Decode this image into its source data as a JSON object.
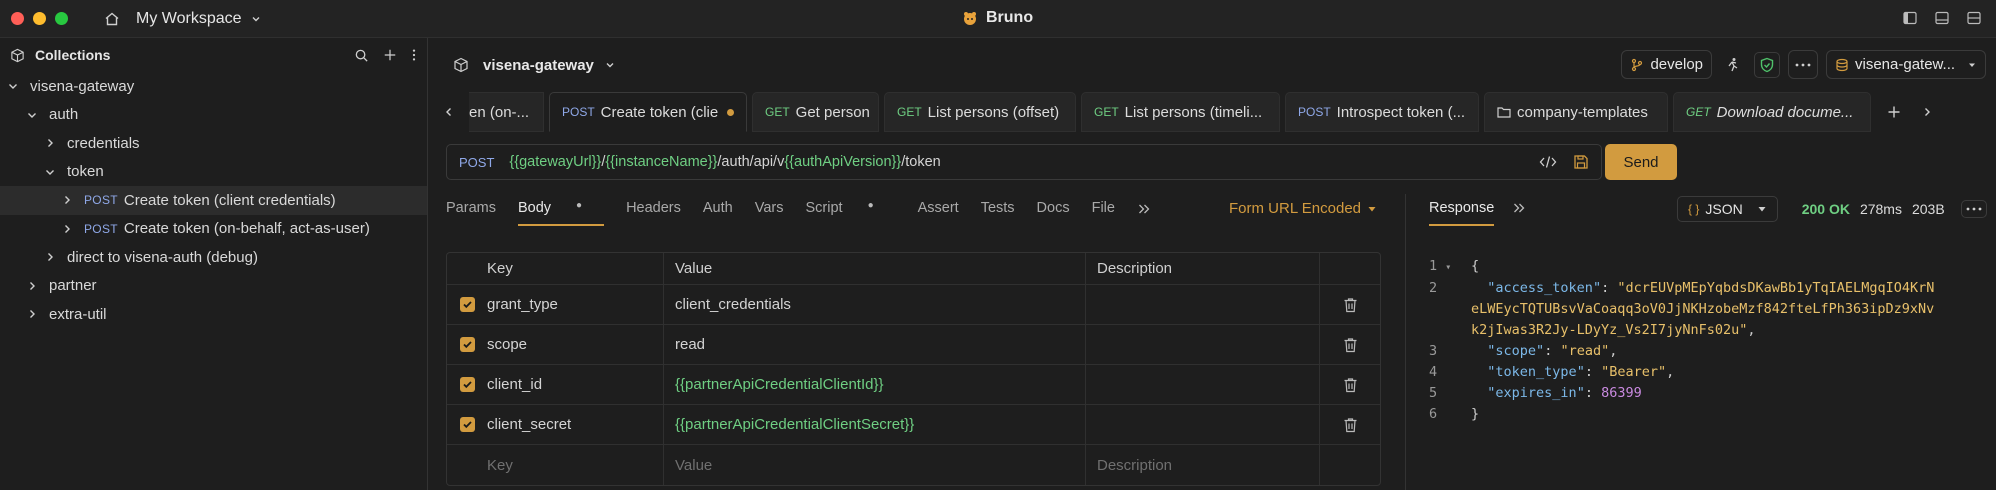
{
  "window": {
    "workspace": "My Workspace",
    "app_title": "Bruno"
  },
  "sidebar": {
    "title": "Collections",
    "tree": [
      {
        "label": "visena-gateway",
        "level": 0,
        "expanded": true
      },
      {
        "label": "auth",
        "level": 1,
        "expanded": true
      },
      {
        "label": "credentials",
        "level": 2,
        "expanded": false
      },
      {
        "label": "token",
        "level": 2,
        "expanded": true
      },
      {
        "method": "POST",
        "label": "Create token (client credentials)",
        "level": 3,
        "selected": true
      },
      {
        "method": "POST",
        "label": "Create token (on-behalf, act-as-user)",
        "level": 3
      },
      {
        "label": "direct to visena-auth (debug)",
        "level": 2,
        "expanded": false
      },
      {
        "label": "partner",
        "level": 1,
        "expanded": false
      },
      {
        "label": "extra-util",
        "level": 1,
        "expanded": false
      }
    ]
  },
  "collection": {
    "name": "visena-gateway",
    "branch": "develop",
    "environment": "visena-gatew..."
  },
  "tabs": [
    {
      "method": "",
      "label": "en (on-..."
    },
    {
      "method": "POST",
      "label": "Create token (clie",
      "active": true,
      "modified": true
    },
    {
      "method": "GET",
      "label": "Get person"
    },
    {
      "method": "GET",
      "label": "List persons (offset)"
    },
    {
      "method": "GET",
      "label": "List persons (timeli..."
    },
    {
      "method": "POST",
      "label": "Introspect token (..."
    },
    {
      "method": "",
      "label": "company-templates",
      "folder": true
    },
    {
      "method": "GET",
      "label": "Download docume...",
      "italic": true
    }
  ],
  "request": {
    "method": "POST",
    "url_parts": [
      {
        "text": "{{gatewayUrl}}",
        "var": true
      },
      {
        "text": "/",
        "var": false
      },
      {
        "text": "{{instanceName}}",
        "var": true
      },
      {
        "text": "/auth/api/v",
        "var": false
      },
      {
        "text": "{{authApiVersion}}",
        "var": true
      },
      {
        "text": "/token",
        "var": false
      }
    ],
    "send_label": "Send",
    "req_tabs": [
      "Params",
      "Body",
      "Headers",
      "Auth",
      "Vars",
      "Script",
      "Assert",
      "Tests",
      "Docs",
      "File"
    ],
    "body_mode": "Form URL Encoded",
    "table": {
      "headers": [
        "Key",
        "Value",
        "Description"
      ],
      "rows": [
        {
          "key": "grant_type",
          "value": "client_credentials",
          "var": false
        },
        {
          "key": "scope",
          "value": "read",
          "var": false
        },
        {
          "key": "client_id",
          "value": "{{partnerApiCredentialClientId}}",
          "var": true
        },
        {
          "key": "client_secret",
          "value": "{{partnerApiCredentialClientSecret}}",
          "var": true
        }
      ],
      "placeholders": {
        "key": "Key",
        "value": "Value",
        "description": "Description"
      }
    }
  },
  "response": {
    "tab_label": "Response",
    "format": "JSON",
    "status": "200 OK",
    "time": "278ms",
    "size": "203B",
    "lines": [
      {
        "n": "1",
        "text": "{"
      },
      {
        "n": "2",
        "key": "access_token",
        "value": "\"dcrEUVpMEpYqbdsDKawBb1yTqIAELMgqIO4KrN"
      },
      {
        "n": "",
        "value": "eLWEycTQTUBsvVaCoaqq3oV0JjNKHzobeMzf842fteLfPh363ipDz9xNv"
      },
      {
        "n": "",
        "value": "k2jIwas3R2Jy-LDyYz_Vs2I7jyNnFs02u\""
      },
      {
        "n": "3",
        "key": "scope",
        "value": "\"read\""
      },
      {
        "n": "4",
        "key": "token_type",
        "value": "\"Bearer\""
      },
      {
        "n": "5",
        "key": "expires_in",
        "value": "86399"
      },
      {
        "n": "6",
        "text": "}"
      }
    ]
  }
}
